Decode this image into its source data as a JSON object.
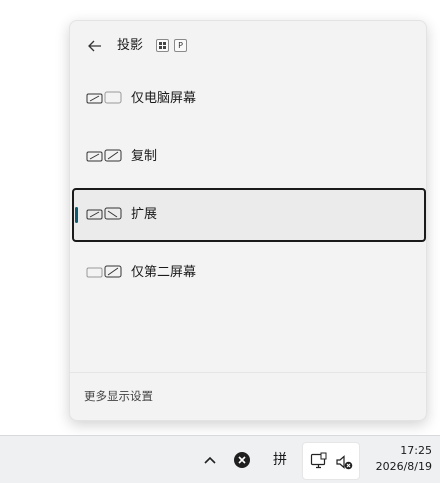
{
  "flyout": {
    "title": "投影",
    "shortcut_key": "P",
    "options": [
      {
        "label": "仅电脑屏幕",
        "selected": false
      },
      {
        "label": "复制",
        "selected": false
      },
      {
        "label": "扩展",
        "selected": true
      },
      {
        "label": "仅第二屏幕",
        "selected": false
      }
    ],
    "footer_link": "更多显示设置",
    "accent_color": "#0f5a6e"
  },
  "taskbar": {
    "ime_label": "拼",
    "time": "17:25",
    "date": "2026/8/19"
  }
}
